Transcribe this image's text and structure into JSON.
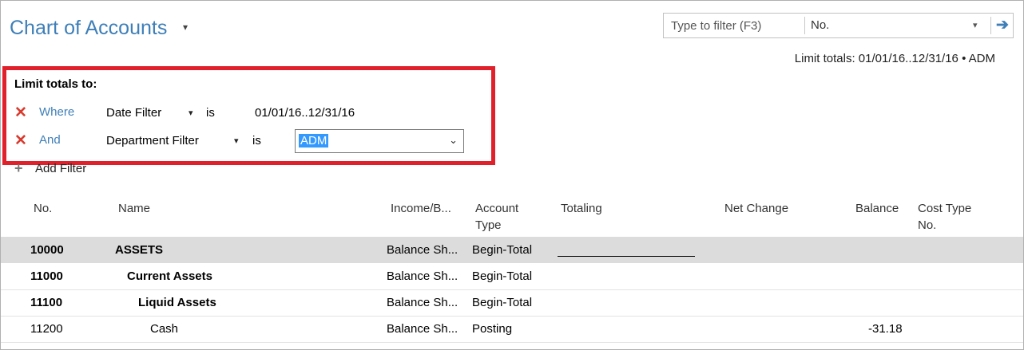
{
  "header": {
    "title": "Chart of Accounts",
    "title_caret": "▾",
    "search": {
      "placeholder": "Type to filter (F3)",
      "field": "No.",
      "field_caret": "▾",
      "go_icon": "arrow-right-icon"
    },
    "limit_summary": "Limit totals: 01/01/16..12/31/16 • ADM"
  },
  "filters": {
    "title": "Limit totals to:",
    "rows": [
      {
        "remove_icon": "✕",
        "op": "Where",
        "field": "Date Filter",
        "caret": "▾",
        "is": "is",
        "value": "01/01/16..12/31/16"
      },
      {
        "remove_icon": "✕",
        "op": "And",
        "field": "Department Filter",
        "caret": "▾",
        "is": "is",
        "value": "ADM",
        "value_caret": "⌄"
      }
    ],
    "add_icon": "+",
    "add_label": "Add Filter"
  },
  "table": {
    "columns": {
      "no": "No.",
      "name": "Name",
      "income_balance": "Income/B...",
      "account_type_1": "Account",
      "account_type_2": "Type",
      "totaling": "Totaling",
      "net_change": "Net Change",
      "balance": "Balance",
      "cost_type_1": "Cost Type",
      "cost_type_2": "No."
    },
    "rows": [
      {
        "no": "10000",
        "name": "ASSETS",
        "income_balance": "Balance Sh...",
        "account_type": "Begin-Total",
        "balance": ""
      },
      {
        "no": "11000",
        "name": "Current Assets",
        "income_balance": "Balance Sh...",
        "account_type": "Begin-Total",
        "balance": ""
      },
      {
        "no": "11100",
        "name": "Liquid Assets",
        "income_balance": "Balance Sh...",
        "account_type": "Begin-Total",
        "balance": ""
      },
      {
        "no": "11200",
        "name": "Cash",
        "income_balance": "Balance Sh...",
        "account_type": "Posting",
        "balance": "-31.18"
      }
    ]
  },
  "colors": {
    "accent": "#3e7fb8",
    "highlight_border": "#e0202a",
    "remove_x": "#d83a2e",
    "selected_row": "#dcdcdc"
  }
}
